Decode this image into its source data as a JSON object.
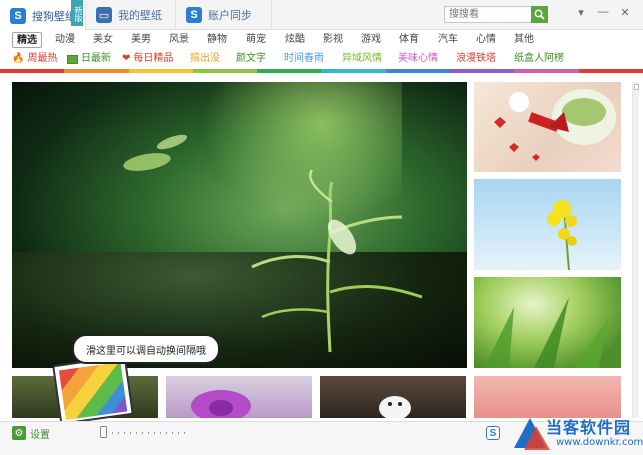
{
  "tabs": [
    {
      "label": "搜狗壁纸",
      "badge": "新版"
    },
    {
      "label": "我的壁纸"
    },
    {
      "label": "账户同步"
    }
  ],
  "search": {
    "placeholder": "搜搜看"
  },
  "categories": [
    "精选",
    "动漫",
    "美女",
    "美男",
    "风景",
    "静物",
    "萌宠",
    "炫酷",
    "影视",
    "游戏",
    "体育",
    "汽车",
    "心情",
    "其他"
  ],
  "subcategories": [
    {
      "label": "周最热",
      "color": "#e23c2e",
      "icon": "flame-icon"
    },
    {
      "label": "日最新",
      "color": "#3f8f2a",
      "icon": "image-icon"
    },
    {
      "label": "每日精品",
      "color": "#e23c2e",
      "icon": "heart-icon"
    },
    {
      "label": "搞出没",
      "color": "#e8a22a"
    },
    {
      "label": "颜文字",
      "color": "#3f8f2a"
    },
    {
      "label": "时间春雨",
      "color": "#4aa0d9"
    },
    {
      "label": "异域风情",
      "color": "#7bb52c"
    },
    {
      "label": "美味心情",
      "color": "#c95cc9"
    },
    {
      "label": "浪漫铁塔",
      "color": "#e23c2e"
    },
    {
      "label": "纸盒人阿楞",
      "color": "#3f8f2a"
    }
  ],
  "colors": {
    "bar": [
      "#e23c2e",
      "#f08a2a",
      "#f5c431",
      "#8cc63e",
      "#33a852",
      "#35b6c9",
      "#3b84d8",
      "#8e5bd0",
      "#d95ca8",
      "#e23c2e"
    ]
  },
  "tooltip": "滑这里可以调自动换间隔哦",
  "bottom": {
    "settings_label": "设置"
  },
  "watermark": {
    "title": "当客软件园",
    "url": "www.downkr.com"
  }
}
